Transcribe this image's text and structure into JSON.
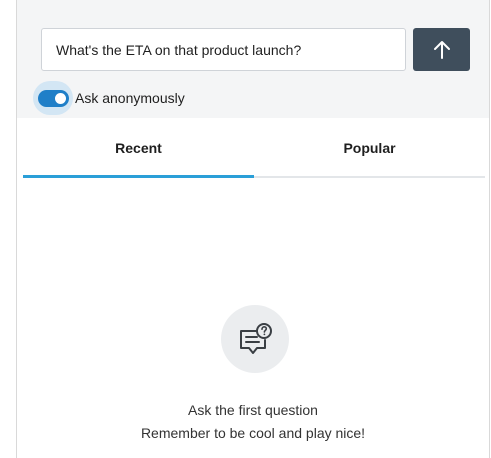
{
  "composer": {
    "question_value": "What's the ETA on that product launch?",
    "submit_icon": "arrow-up-icon",
    "anonymous_label": "Ask anonymously",
    "anonymous_enabled": true
  },
  "tabs": [
    {
      "label": "Recent",
      "selected": true
    },
    {
      "label": "Popular",
      "selected": false
    }
  ],
  "empty_state": {
    "icon": "question-list-icon",
    "title": "Ask the first question",
    "subtitle": "Remember to be cool and play nice!"
  },
  "colors": {
    "accent": "#1f7fc8",
    "tab_indicator": "#2a9fd8",
    "submit_button": "#3f4e5c",
    "header_background": "#f4f5f6"
  }
}
